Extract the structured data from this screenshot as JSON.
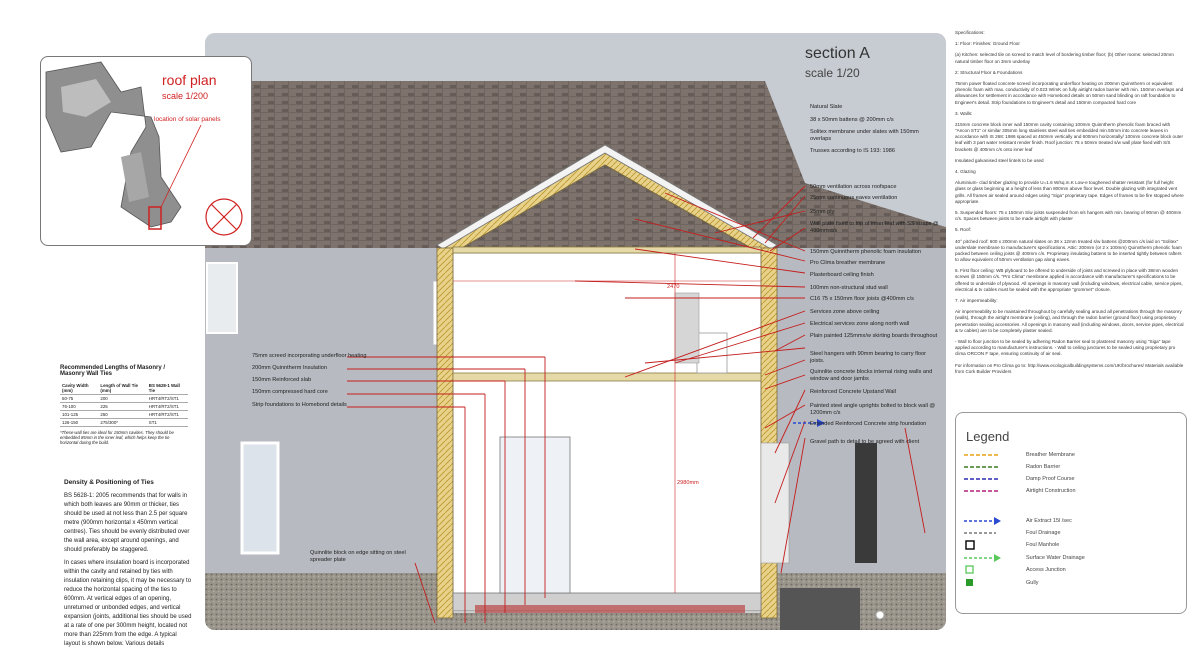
{
  "section": {
    "title": "section A",
    "scale": "scale 1/20"
  },
  "roof_plan": {
    "title": "roof plan",
    "scale": "scale 1/200",
    "label": "location of solar panels"
  },
  "right_annotations": [
    "Natural Slate",
    "38 x 50mm battens @ 200mm c/s",
    "Solitex membrane under slates with 150mm overlaps",
    "Trusses according to IS 193: 1986",
    "50mm ventilation across roofspace",
    "25mm continuous eaves ventilation",
    "25mm ply",
    "Wall plate fixed to top of inner leaf with SS straps @ 400mm c/s",
    "150mm Quinntherm phenolic foam insulation",
    "Pro Clima breather membrane",
    "Plasterboard ceiling finish",
    "100mm non-structural stud wall",
    "C16 75 x 150mm floor joists @400mm c/s",
    "Services zone above ceiling",
    "Electrical services zone along north wall",
    "Plain painted 125mmx/w skirting boards throughout",
    "Steel hangers with 90mm bearing to carry floor joists.",
    "Quinnlite concrete blocks internal rising walls and window and door jambs",
    "Reinforced Concrete Upstand Wall",
    "Painted steel angle uprights bolted to block wall @ 1200mm c/s",
    "Extended Reinforced Concrete strip foundation",
    "Gravel path to detail to be agreed with client"
  ],
  "left_annotations": [
    "75mm screed incorporating underfloor heating",
    "200mm Quinntherm Insulation",
    "150mm Reinforced slab",
    "150mm compressed hard core",
    "Strip foundations to Homebond details",
    "Quinnlite block on edge sitting on steel spreader plate"
  ],
  "dims": {
    "d1": "2470",
    "d2": "2980mm"
  },
  "specs": {
    "heading": "Specifications:",
    "s1_title": "1: Floor: Finishes: Ground Floor",
    "s1_text": "(a) Kitchen: selected tile on screed to match level of bordering timber floor; (b) Other rooms: selected 20mm natural timber floor on 3mm underlay",
    "s2_title": "2: Structural Floor & Foundations",
    "s2_text": "75mm power floated concrete screed incorporating underfloor heating on 200mm Quinntherm or equivalent phenolic foam with max. conductivity of 0.023 W/mK on fully airtight radon barrier with min. 150mm overlaps and allowances for settlement in accordance with Homebond details on 50mm sand blinding on raft foundation to Engineer's detail. Strip foundations to Engineer's detail and 150mm compacted hard core",
    "s3_title": "3. Walls:",
    "s3_text": "215mm concrete block inner wall 150mm cavity containing 100mm Quinntherm phenolic foam braced with \"Ancon ST1\" or similar 305mm long stainless steel wall ties embedded min.50mm into concrete leaves in accordance with IS 268: 1986 spaced at 450mm vertically and 600mm horizontally/ 100mm concrete block outer leaf with 3 part water resistant render finish. Roof junction: 75 x 50mm treated s/w wall plate fixed with S/S brackets @ 400mm c/s onto inner leaf",
    "s3_text2": "Insulated galvanised steel lintels to be used",
    "s4_title": "4. Glazing",
    "s4_text": "Aluminium- clad timber glazing to provide U=1.6 W/sq.m.K Low-e toughened shatter resistant (for full height glass or glass beginning at a height of less than 800mm above floor level. Double glazing with integrated vent grills. All frames air sealed around edges using \"Siga\" proprietary tape. Edges of frames to be fire stopped where appropriate.",
    "s5_title": "5. Suspended floors: 75 x 150mm S/w joists suspended from s/s hangers with min. bearing of 90mm @ 400mm c/s. Spaces between joists to be made airtight with plaster",
    "s5_title2": "5. Roof:",
    "s5_text": "40° pitched roof: 600 x 200mm natural slates on 38 x 12mm treated s/w battens @200mm c/s laid on \"Solitex\" underslate membrane to manufacturer's specifications. Attic: 200mm (or 2 x 100mm) Quinntherm phenolic foam packed between ceiling joists @ 400mm c/s. Proprietary insulating battens to be inserted tightly between rafters to allow equivalent of 50mm ventilation gap along eaves.",
    "s6_text": "6. First floor ceiling: WB plyboard to be offered to underside of joists and screwed in place with 38mm wooden screws @ 150mm c/s. \"Pro Clima\" membrane applied in accordance with manufacturer's specifications to be offered to underside of plywood. All openings in masonry wall (including windows, electrical cable, service pipes, electrical & tv cables must be sealed with the appropriate \"grommet\" closure.",
    "s7_title": "7. Air impermeability:",
    "s7_text": "Air impermeability to be maintained throughout by carefully sealing around all penetrations through the masonry (walls), through the airtight membrane (ceiling), and through the radon barrier (ground floor) using proprietary penetration sealing accessories. All openings in masonry wall (including windows, doors, service pipes, electrical & tv cables) are to be completely plaster sealed.",
    "s7_text2": "- Wall to floor junction to be sealed by adhering Radon Barrier seal to plastered masonry using \"Siga\" tape applied according to manufacturer's instructions. - Wall to ceiling junctures to be sealed using proprietary pro clima ORCON F tape, ensuring continuity of air seal.",
    "s7_text3": "For information on Pro Clima go to: http://www.ecologicalbuildingsystems.com/UK/brochures/ Materials available from Cork Builder Providers"
  },
  "legend": {
    "title": "Legend",
    "items": [
      {
        "label": "Breather Membrane",
        "color": "#e8a317"
      },
      {
        "label": "Radon Barrier",
        "color": "#3a7d1e"
      },
      {
        "label": "Damp Proof Course",
        "color": "#2a2ab0"
      },
      {
        "label": "Airtight Construction",
        "color": "#b0207a"
      },
      {
        "label": "Air Extract 15l /sec",
        "color": "#2a4ad0"
      },
      {
        "label": "Foul Drainage",
        "color": "#333333"
      },
      {
        "label": "Foul Manhole",
        "color": "#111111"
      },
      {
        "label": "Surface Water Drainage",
        "color": "#5ac85a"
      },
      {
        "label": "Access Junction",
        "color": "#5ac85a"
      },
      {
        "label": "Gully",
        "color": "#2a9a2a"
      }
    ]
  },
  "tiles_table": {
    "title": "Recommended Lengths of Masonry / Masonry Wall Ties",
    "headers": [
      "Cavity Width (mm)",
      "Length of Wall Tie (mm)",
      "BS 5628-1 Wall Tie"
    ],
    "rows": [
      [
        "50-75",
        "200",
        "HRT4/RT2/ST1"
      ],
      [
        "76-100",
        "225",
        "HRT4/RT2/ST1"
      ],
      [
        "101-125",
        "250",
        "HRT4/RT2/ST1"
      ],
      [
        "126-150",
        "275/300*",
        "ST1"
      ]
    ],
    "note": "*These wall ties are ideal for 150mm cavities. They should be embedded 85mm in the inner leaf, which helps keep the tie horizontal during the build."
  },
  "density": {
    "title": "Density & Positioning of Ties",
    "p1": "BS 5628-1: 2005 recommends that for walls in which both leaves are 90mm or thicker, ties should be used at not less than 2.5 per square metre (900mm horizontal x 450mm vertical centres). Ties should be evenly distributed over the wall area, except around openings, and should preferably be staggered.",
    "p2": "In cases where insulation board is incorporated within the cavity and retained by ties with insulation retaining clips, it may be necessary to reduce the horizontal spacing of the ties to 600mm. At vertical edges of an opening, unreturned or unbonded edges, and vertical expansion (joints, additional ties should be used at a rate of one per 300mm height, located not more than 225mm from the edge. A typical layout is shown below. Various details"
  }
}
